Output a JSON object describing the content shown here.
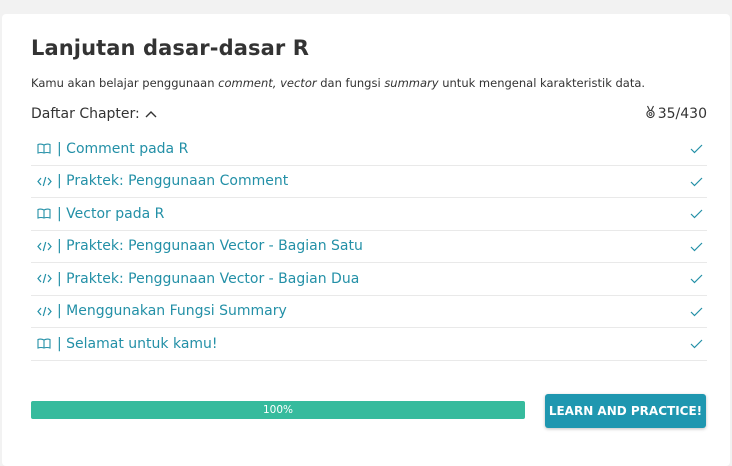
{
  "course": {
    "title": "Lanjutan dasar-dasar R",
    "description": {
      "before": "Kamu akan belajar penggunaan ",
      "em1": "comment, vector",
      "middle": " dan fungsi ",
      "em2": "summary",
      "after": " untuk mengenal karakteristik data."
    }
  },
  "chapters": {
    "heading": "Daftar Chapter:",
    "points": "35/430",
    "toggle_icon": "chevron-up-icon",
    "points_icon": "medal-icon",
    "items": [
      {
        "icon": "book-icon",
        "label": "| Comment pada R",
        "completed": true
      },
      {
        "icon": "code-icon",
        "label": "| Praktek: Penggunaan Comment",
        "completed": true
      },
      {
        "icon": "book-icon",
        "label": "| Vector pada R",
        "completed": true
      },
      {
        "icon": "code-icon",
        "label": "| Praktek: Penggunaan Vector - Bagian Satu",
        "completed": true
      },
      {
        "icon": "code-icon",
        "label": "| Praktek: Penggunaan Vector - Bagian Dua",
        "completed": true
      },
      {
        "icon": "code-icon",
        "label": "| Menggunakan Fungsi Summary",
        "completed": true
      },
      {
        "icon": "book-icon",
        "label": "| Selamat untuk kamu!",
        "completed": true
      }
    ]
  },
  "progress": {
    "percent": 100,
    "label": "100%"
  },
  "cta": {
    "label": "LEARN AND PRACTICE!"
  },
  "colors": {
    "link": "#2390a7",
    "progress_fill": "#36bb9d",
    "button": "#1f97b0",
    "check": "#2390a7"
  }
}
